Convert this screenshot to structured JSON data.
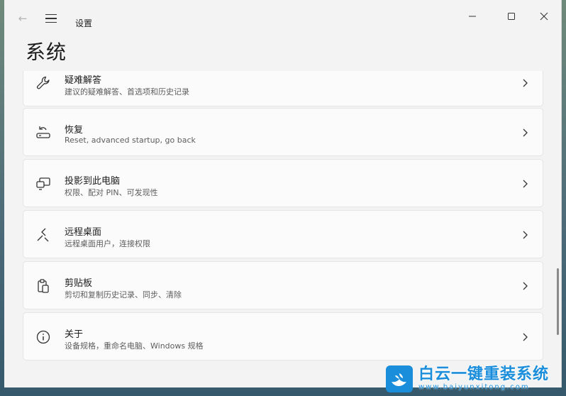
{
  "window": {
    "app_title": "设置",
    "page_heading": "系统",
    "back_icon": "←"
  },
  "cards": [
    {
      "icon": "wrench-icon",
      "title": "疑难解答",
      "description": "建议的疑难解答、首选项和历史记录"
    },
    {
      "icon": "recovery-icon",
      "title": "恢复",
      "description": "Reset, advanced startup, go back"
    },
    {
      "icon": "project-to-pc-icon",
      "title": "投影到此电脑",
      "description": "权限、配对 PIN、可发现性"
    },
    {
      "icon": "remote-desktop-icon",
      "title": "远程桌面",
      "description": "远程桌面用户，连接权限"
    },
    {
      "icon": "clipboard-icon",
      "title": "剪贴板",
      "description": "剪切和复制历史记录、同步、清除"
    },
    {
      "icon": "info-icon",
      "title": "关于",
      "description": "设备规格，重命名电脑、Windows 规格"
    }
  ],
  "watermark": {
    "title": "白云一键重装系统",
    "url": "www.baiyunxitong.com"
  },
  "colors": {
    "window_bg": "#f3f3f3",
    "card_bg": "#fbfbfb",
    "accent": "#1a8ddb"
  }
}
